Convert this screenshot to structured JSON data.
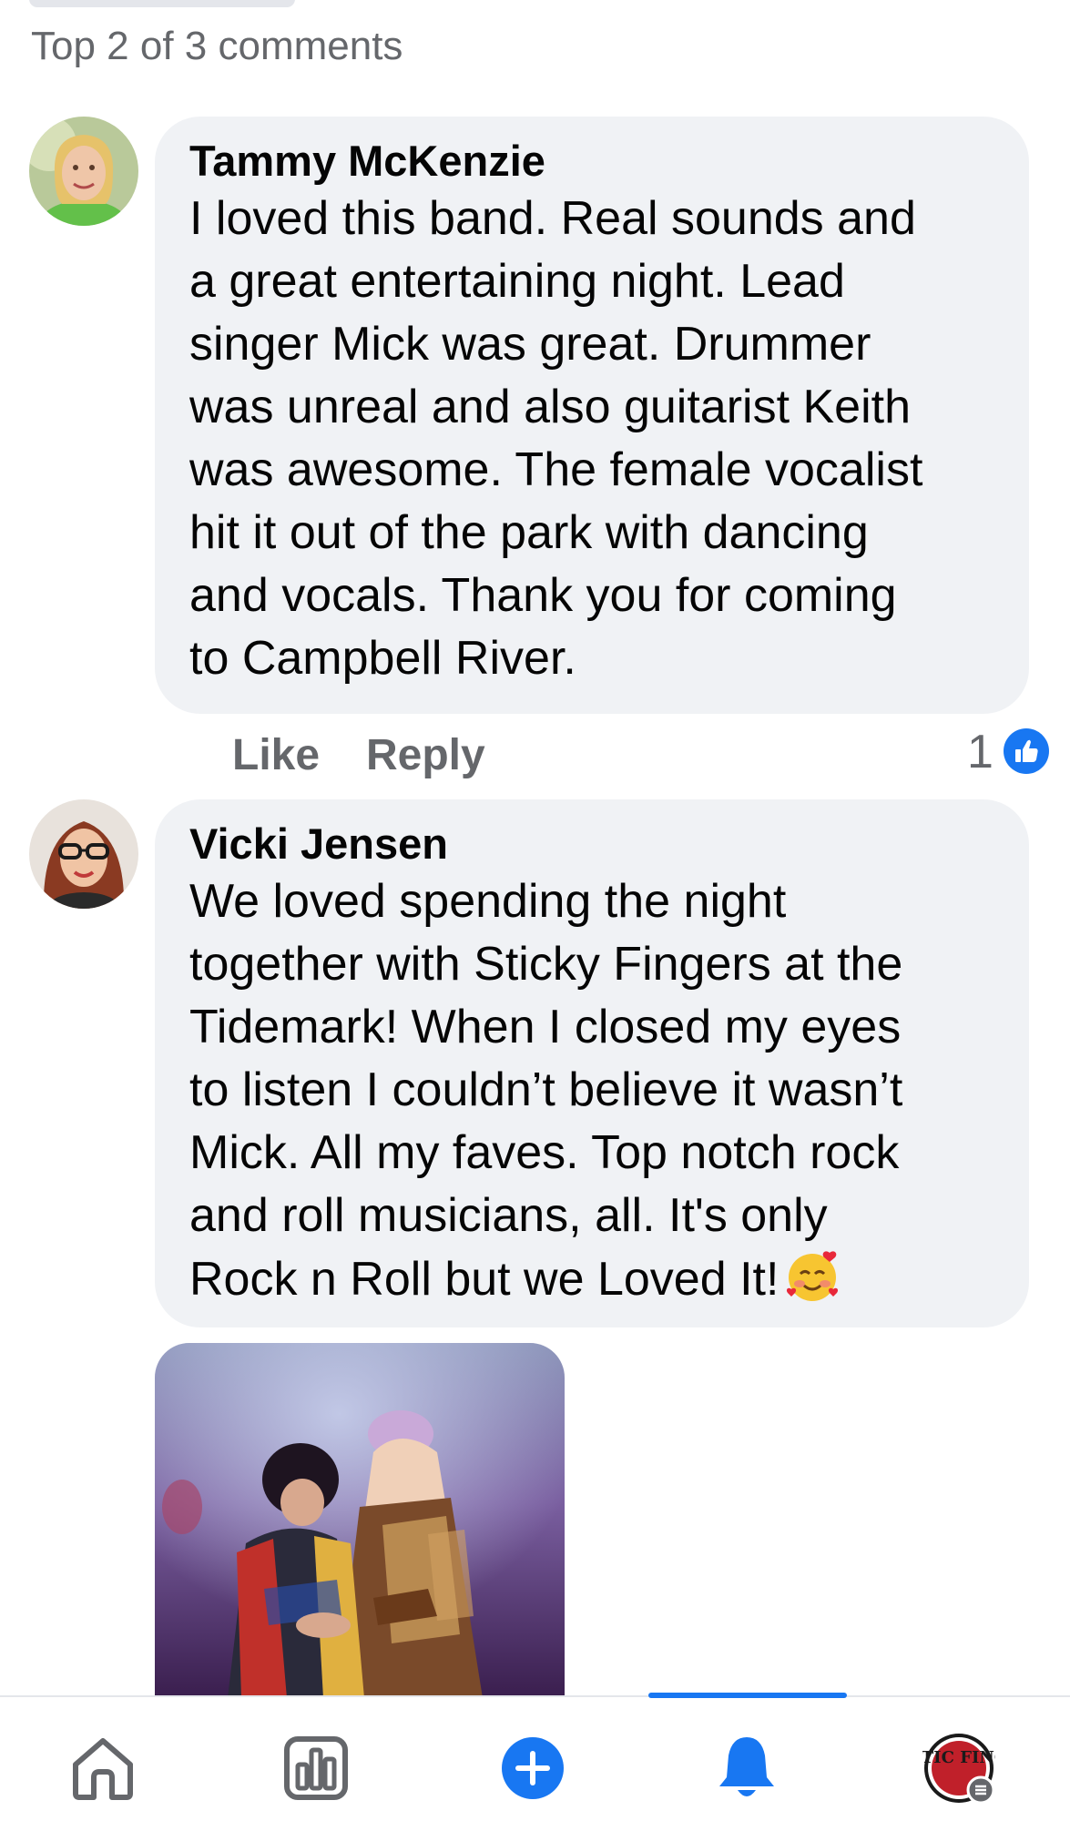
{
  "header": {
    "comments_label": "Top 2 of 3 comments"
  },
  "comments": [
    {
      "author": "Tammy McKenzie",
      "text": "I loved this band.  Real sounds and\na great entertaining night.  Lead\nsinger Mick was great.  Drummer\nwas unreal and also guitarist Keith\nwas awesome.  The female vocalist\nhit it out of the park with dancing\nand vocals.  Thank you for coming\nto Campbell River.",
      "like_label": "Like",
      "reply_label": "Reply",
      "reaction_count": "1",
      "reaction_icon": "thumbs-up-icon"
    },
    {
      "author": "Vicki Jensen",
      "text": "We loved spending the night\ntogether with Sticky Fingers at the\nTidemark!  When I closed my eyes\nto listen I couldn’t believe it wasn’t\nMick.  All my faves.  Top notch rock\nand roll musicians, all.  It's only\nRock n Roll but we Loved It!",
      "emoji": "smiling-face-with-hearts-icon"
    }
  ],
  "tab_bar": {
    "items": [
      "home-icon",
      "dashboard-icon",
      "create-icon",
      "notifications-icon",
      "profile-icon"
    ],
    "active": "notifications-icon",
    "profile_avatar_text": "STIC FING"
  },
  "colors": {
    "accent": "#1877f2",
    "bubble": "#f0f2f5",
    "secondary_text": "#65676b"
  }
}
